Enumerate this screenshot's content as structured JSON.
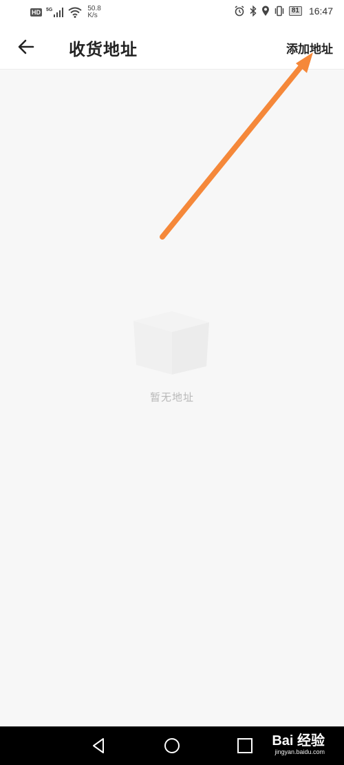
{
  "status_bar": {
    "hd": "HD",
    "network": "5G",
    "speed_value": "50.8",
    "speed_unit": "K/s",
    "battery": "81",
    "time": "16:47"
  },
  "header": {
    "title": "收货地址",
    "add_label": "添加地址"
  },
  "empty_state": {
    "text": "暂无地址"
  },
  "annotation": {
    "arrow_color": "#f5883a"
  },
  "watermark": {
    "main": "Bai 经验",
    "sub": "jingyan.baidu.com"
  },
  "icons": [
    "back-arrow-icon",
    "alarm-icon",
    "bluetooth-icon",
    "location-icon",
    "vibrate-icon",
    "battery-icon",
    "wifi-icon",
    "signal-icon",
    "back-triangle-icon",
    "home-circle-icon",
    "recents-square-icon",
    "box-icon"
  ]
}
